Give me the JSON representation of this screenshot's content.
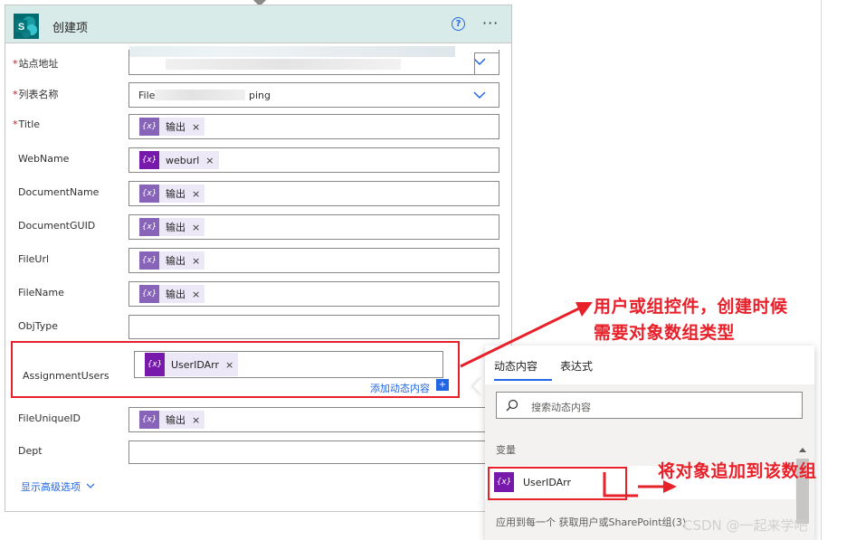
{
  "card": {
    "title": "创建项",
    "help_glyph": "?",
    "more_glyph": "···",
    "logo_letter": "S"
  },
  "fields": [
    {
      "label": "站点地址",
      "required": true
    },
    {
      "label": "列表名称",
      "required": true,
      "value_prefix": "File",
      "value_suffix": "ping"
    },
    {
      "label": "Title",
      "required": true,
      "token": "输出"
    },
    {
      "label": "WebName",
      "required": false,
      "token": "weburl"
    },
    {
      "label": "DocumentName",
      "required": false,
      "token": "输出"
    },
    {
      "label": "DocumentGUID",
      "required": false,
      "token": "输出"
    },
    {
      "label": "FileUrl",
      "required": false,
      "token": "输出"
    },
    {
      "label": "FileName",
      "required": false,
      "token": "输出"
    },
    {
      "label": "ObjType",
      "required": false
    },
    {
      "label": "AssignmentUsers",
      "required": false,
      "token": "UserIDArr"
    },
    {
      "label": "FileUniqueID",
      "required": false,
      "token": "输出"
    },
    {
      "label": "Dept",
      "required": false
    }
  ],
  "token_icon_glyph": "{x}",
  "remove_glyph": "×",
  "required_mark": "*",
  "add_dynamic_label": "添加动态内容",
  "show_advanced_label": "显示高级选项",
  "dynamic_panel": {
    "tabs": [
      "动态内容",
      "表达式"
    ],
    "search_placeholder": "搜索动态内容",
    "section_label": "变量",
    "variable_item": "UserIDArr",
    "apply_section": "应用到每一个 获取用户或SharePoint组(3)"
  },
  "annotations": {
    "line1": "用户或组控件，创建时候",
    "line2": "需要对象数组类型",
    "append": "将对象追加到该数组"
  },
  "watermark": "CSDN @一起来学吧",
  "colors": {
    "header_bg": "#d9ebe9",
    "annotation_red": "#e8202a",
    "token_purple": "#8764b8",
    "variable_purple": "#7719aa",
    "link_blue": "#2266e3"
  }
}
